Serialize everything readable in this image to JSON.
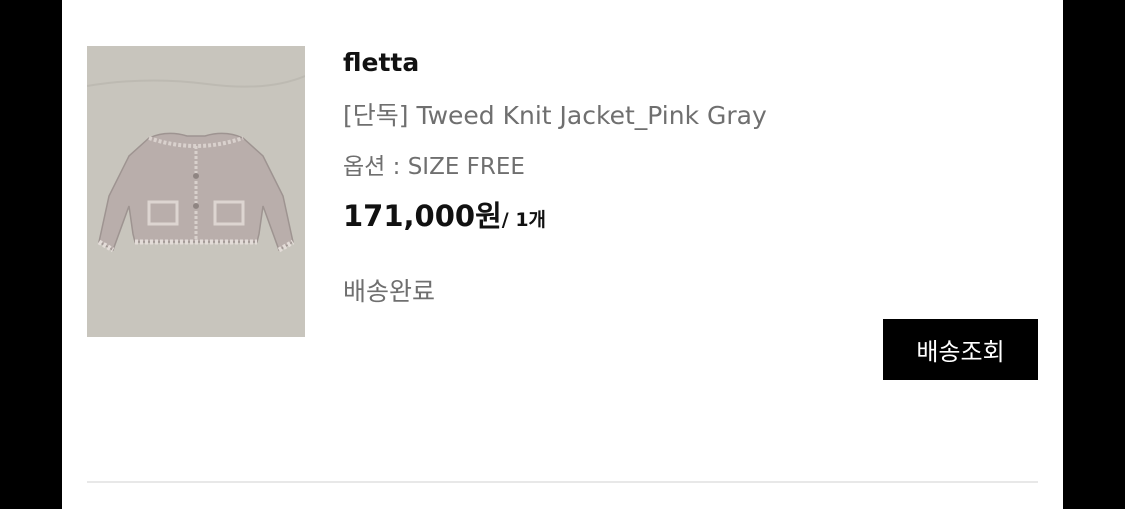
{
  "order_item": {
    "brand": "fletta",
    "product_name": "[단독] Tweed Knit Jacket_Pink Gray",
    "option": "옵션 : SIZE FREE",
    "price": "171,000원",
    "quantity": "/ 1개",
    "status": "배송완료",
    "track_button_label": "배송조회",
    "thumbnail_icon": "pink-gray-tweed-jacket-photo"
  },
  "colors": {
    "background": "#000000",
    "panel": "#ffffff",
    "button": "#000000",
    "button_text": "#ffffff",
    "muted_text": "#6f6f6f",
    "divider": "#e8e8e8"
  }
}
